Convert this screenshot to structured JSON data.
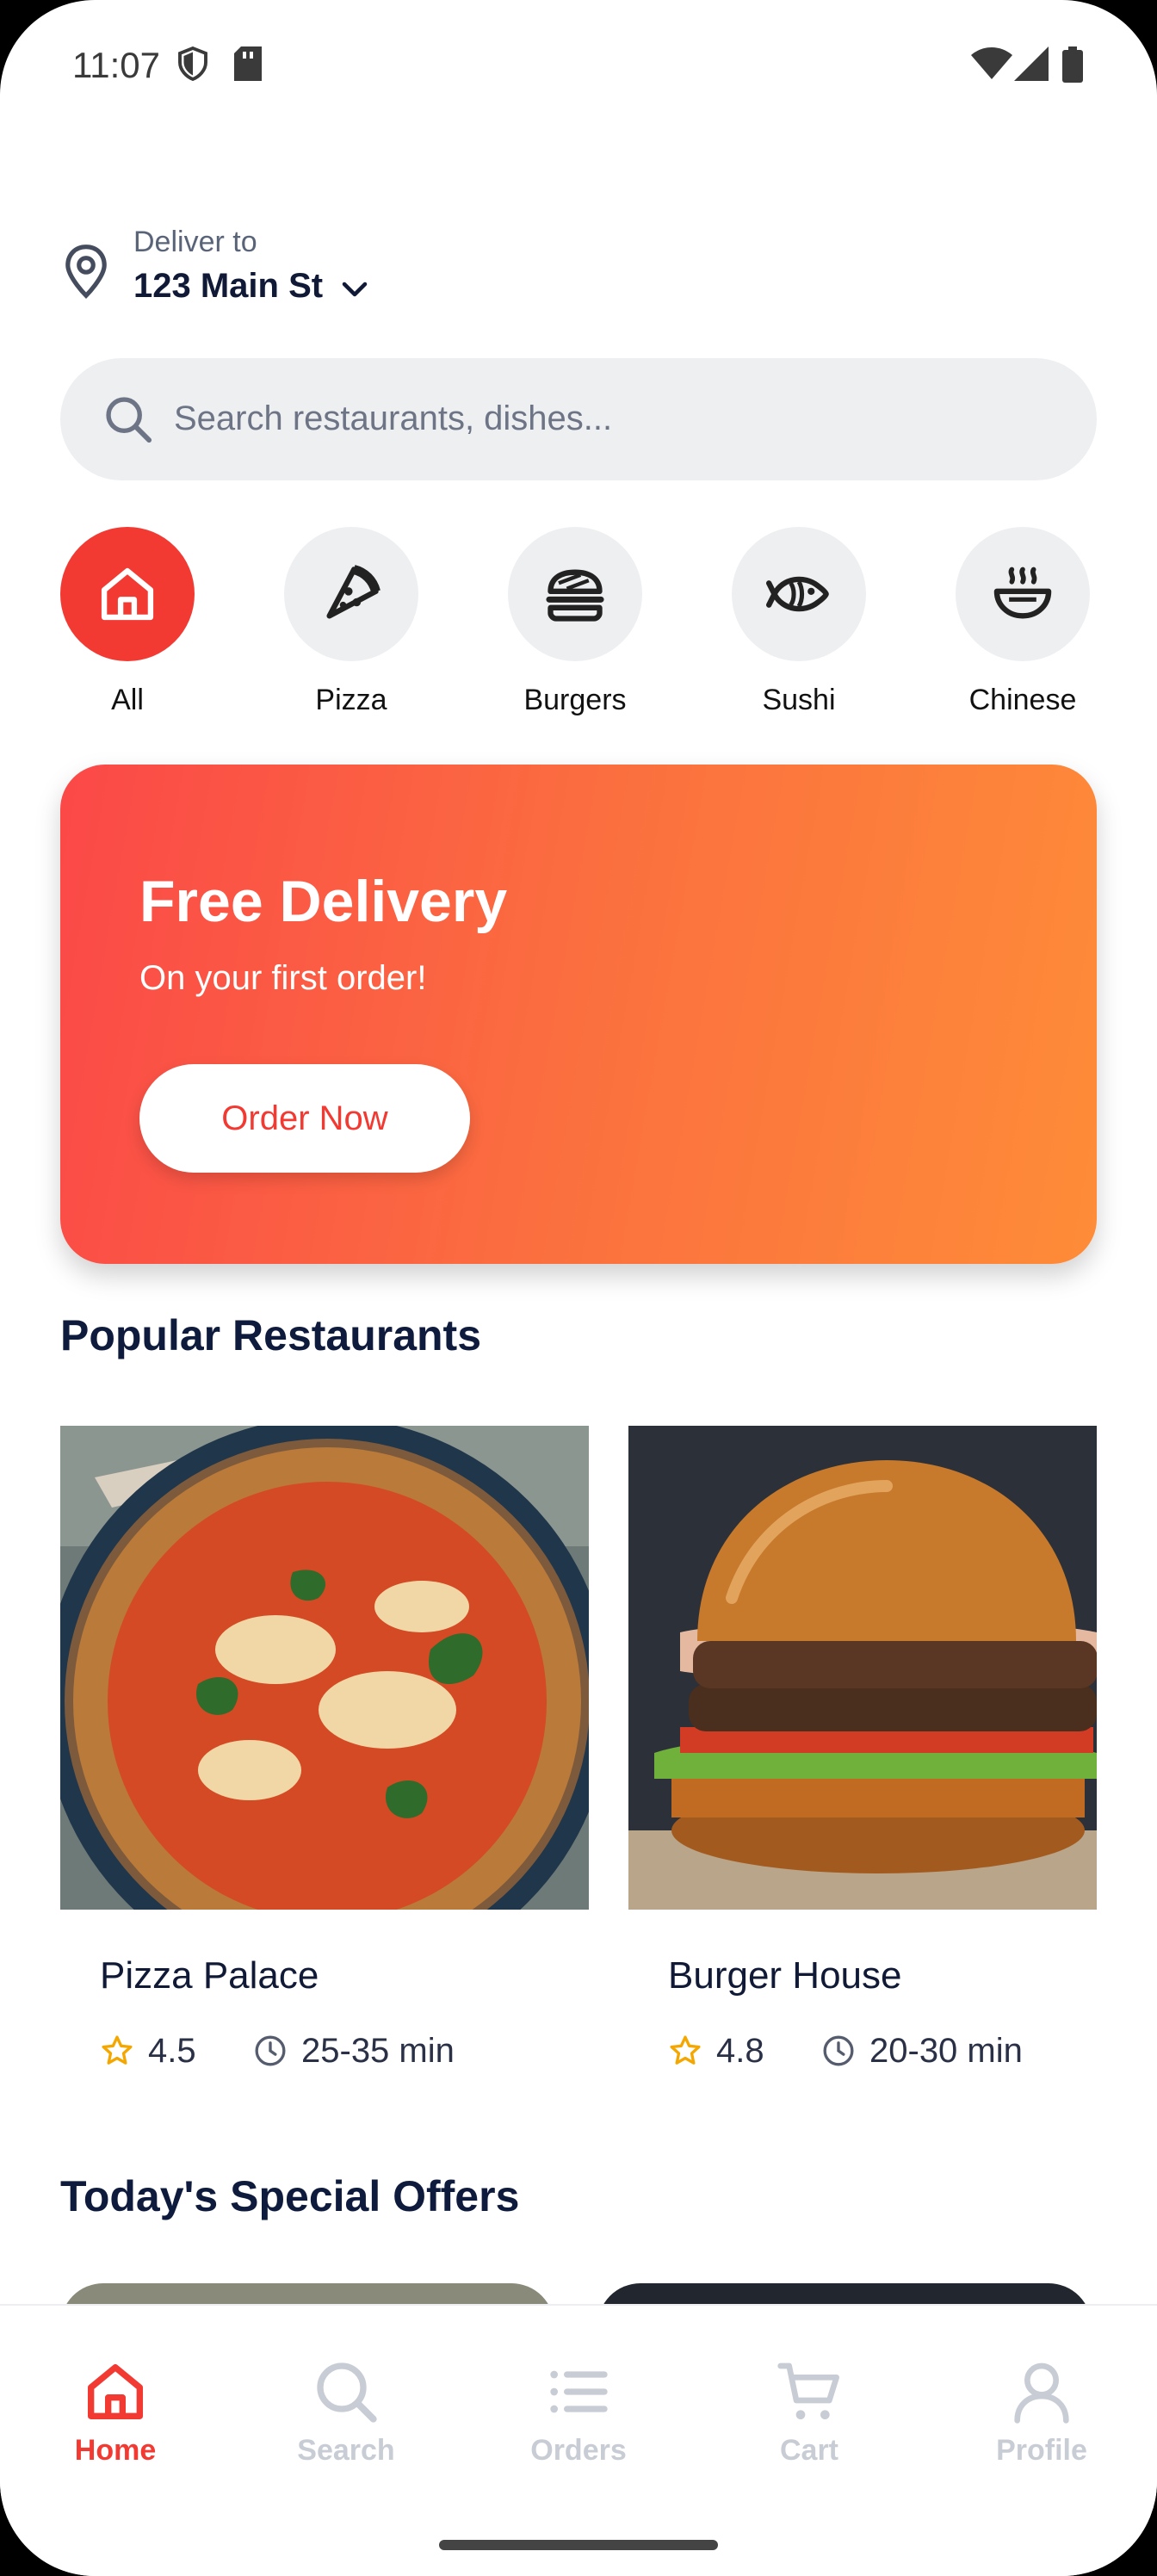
{
  "status_bar": {
    "time": "11:07"
  },
  "location": {
    "label": "Deliver to",
    "address": "123 Main St"
  },
  "search": {
    "placeholder": "Search restaurants, dishes..."
  },
  "categories": [
    {
      "label": "All",
      "icon": "home-icon",
      "active": true
    },
    {
      "label": "Pizza",
      "icon": "pizza-icon"
    },
    {
      "label": "Burgers",
      "icon": "burger-icon"
    },
    {
      "label": "Sushi",
      "icon": "fish-icon"
    },
    {
      "label": "Chinese",
      "icon": "bowl-icon"
    }
  ],
  "banner": {
    "title": "Free Delivery",
    "subtitle": "On your first order!",
    "button": "Order Now"
  },
  "popular": {
    "heading": "Popular Restaurants",
    "items": [
      {
        "name": "Pizza Palace",
        "rating": "4.5",
        "time": "25-35 min"
      },
      {
        "name": "Burger House",
        "rating": "4.8",
        "time": "20-30 min"
      }
    ]
  },
  "offers": {
    "heading": "Today's Special Offers"
  },
  "nav": [
    {
      "label": "Home",
      "icon": "home-icon",
      "active": true
    },
    {
      "label": "Search",
      "icon": "search-icon"
    },
    {
      "label": "Orders",
      "icon": "list-icon"
    },
    {
      "label": "Cart",
      "icon": "cart-icon"
    },
    {
      "label": "Profile",
      "icon": "user-icon"
    }
  ],
  "colors": {
    "accent": "#f23a33",
    "text_dark": "#101a36",
    "muted": "#c8ccd4"
  }
}
